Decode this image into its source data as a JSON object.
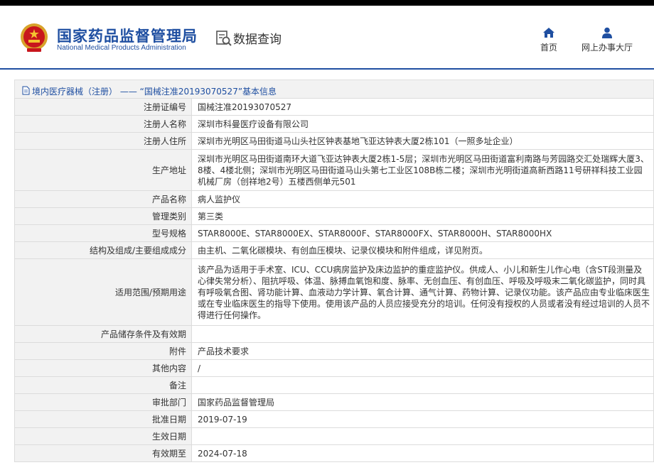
{
  "header": {
    "org_name_cn": "国家药品监督管理局",
    "org_name_en": "National Medical Products Administration",
    "query_label": "数据查询",
    "nav_home": "首页",
    "nav_office": "网上办事大厅"
  },
  "colors": {
    "brand": "#1f4fa1",
    "label_bg": "#f2f2f2",
    "border": "#dcdcdc"
  },
  "breadcrumb": {
    "icon": "document-icon",
    "text": "境内医疗器械（注册） —— “国械注准20193070527”基本信息"
  },
  "record": {
    "rows": [
      {
        "label": "注册证编号",
        "value": "国械注准20193070527"
      },
      {
        "label": "注册人名称",
        "value": "深圳市科曼医疗设备有限公司"
      },
      {
        "label": "注册人住所",
        "value": "深圳市光明区马田街道马山头社区钟表基地飞亚达钟表大厦2栋101（一照多址企业）"
      },
      {
        "label": "生产地址",
        "value": "深圳市光明区马田街道南环大道飞亚达钟表大厦2栋1-5层；深圳市光明区马田街道富利南路与芳园路交汇处瑞辉大厦3、8楼、4楼北侧；深圳市光明区马田街道马山头第七工业区108B栋二楼；深圳市光明街道高新西路11号研祥科技工业园机械厂房（创祥地2号）五楼西侧单元501"
      },
      {
        "label": "产品名称",
        "value": "病人监护仪"
      },
      {
        "label": "管理类别",
        "value": "第三类"
      },
      {
        "label": "型号规格",
        "value": "STAR8000E、STAR8000EX、STAR8000F、STAR8000FX、STAR8000H、STAR8000HX"
      },
      {
        "label": "结构及组成/主要组成成分",
        "value": "由主机、二氧化碳模块、有创血压模块、记录仪模块和附件组成，详见附页。"
      },
      {
        "label": "适用范围/预期用途",
        "value": "该产品为适用于手术室、ICU、CCU病房监护及床边监护的重症监护仪。供成人、小儿和新生儿作心电（含ST段测量及心律失常分析）、阻抗呼吸、体温、脉搏血氧饱和度、脉率、无创血压、有创血压、呼吸及呼吸末二氧化碳监护，同时具有呼吸氧合图、肾功能计算、血液动力学计算、氧合计算、通气计算、药物计算、记录仪功能。该产品应由专业临床医生或在专业临床医生的指导下使用。使用该产品的人员应接受充分的培训。任何没有授权的人员或者没有经过培训的人员不得进行任何操作。"
      },
      {
        "label": "产品储存条件及有效期",
        "value": ""
      },
      {
        "label": "附件",
        "value": "产品技术要求"
      },
      {
        "label": "其他内容",
        "value": "/"
      },
      {
        "label": "备注",
        "value": ""
      },
      {
        "label": "审批部门",
        "value": "国家药品监督管理局"
      },
      {
        "label": "批准日期",
        "value": "2019-07-19"
      },
      {
        "label": "生效日期",
        "value": ""
      },
      {
        "label": "有效期至",
        "value": "2024-07-18"
      }
    ]
  }
}
